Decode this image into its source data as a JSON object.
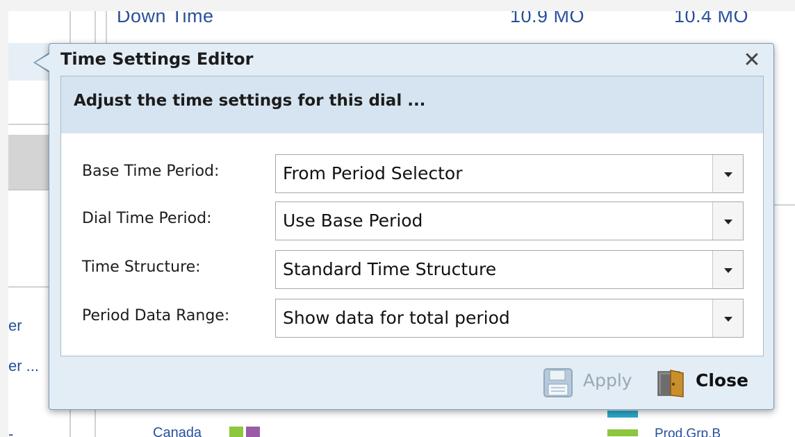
{
  "background": {
    "top_row": {
      "label": "Down Time",
      "value1": "10.9 MO",
      "value2": "10.4 MO"
    },
    "links": [
      "er",
      "er ..."
    ],
    "chart_label": "Canada",
    "legend_item": "Prod.Grp.B",
    "colors": {
      "link": "#27509a",
      "bar_green": "#8dc63f",
      "bar_purple": "#9a5ca6",
      "legend_teal": "#2aa6c6"
    }
  },
  "dialog": {
    "title": "Time Settings Editor",
    "close_glyph": "✕",
    "header": "Adjust the time settings for this dial ...",
    "fields": [
      {
        "label": "Base Time Period:",
        "value": "From Period Selector"
      },
      {
        "label": "Dial Time Period:",
        "value": "Use Base Period"
      },
      {
        "label": "Time Structure:",
        "value": "Standard Time Structure"
      },
      {
        "label": "Period Data Range:",
        "value": "Show data for total period"
      }
    ],
    "buttons": {
      "apply": {
        "label": "Apply",
        "icon": "floppy-disk-icon",
        "enabled": false
      },
      "close": {
        "label": "Close",
        "icon": "door-icon"
      }
    },
    "colors": {
      "frame": "#e3edf6",
      "border": "#7c98b6",
      "header_band": "#d6e4f1"
    }
  }
}
